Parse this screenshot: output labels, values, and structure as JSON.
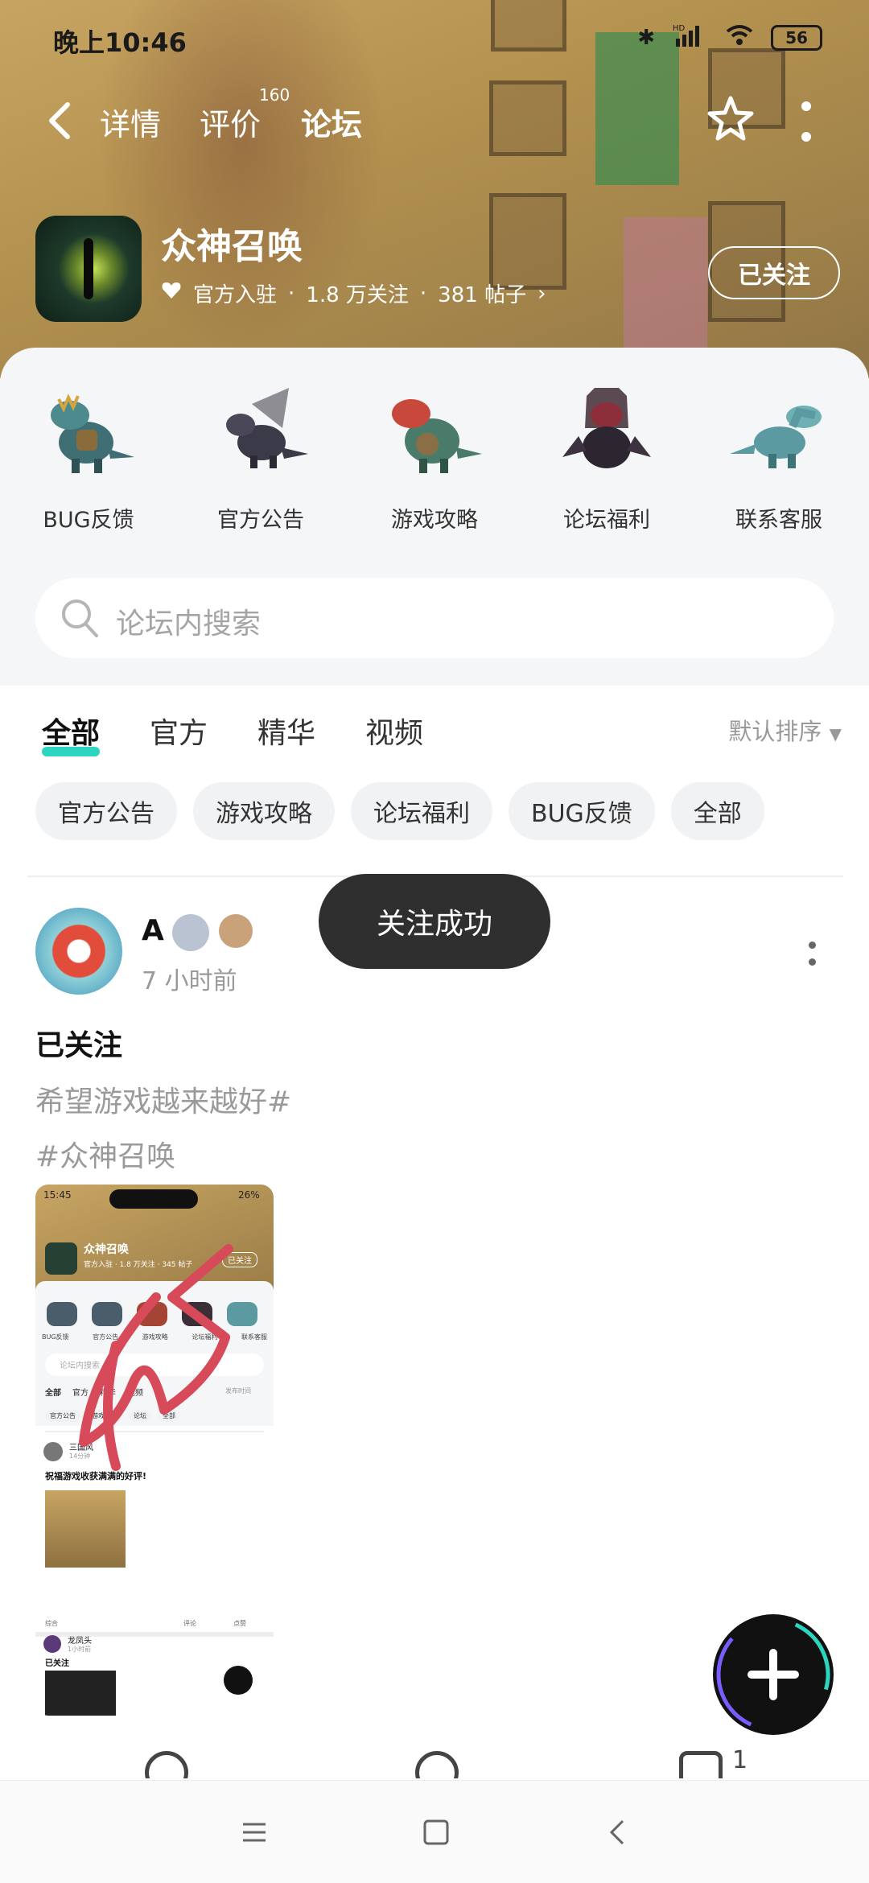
{
  "status_bar": {
    "time": "晚上10:46",
    "battery": "56",
    "network": "HD"
  },
  "nav": {
    "tabs": [
      {
        "label": "详情"
      },
      {
        "label": "评价"
      },
      {
        "label": "论坛"
      }
    ],
    "review_count": "160",
    "active_tab": "论坛"
  },
  "game": {
    "name": "众神召唤",
    "official": "官方入驻",
    "followers": "1.8 万关注",
    "posts": "381 帖子",
    "follow_label": "已关注"
  },
  "shortcuts": [
    {
      "label": "BUG反馈"
    },
    {
      "label": "官方公告"
    },
    {
      "label": "游戏攻略"
    },
    {
      "label": "论坛福利"
    },
    {
      "label": "联系客服"
    }
  ],
  "search": {
    "placeholder": "论坛内搜索"
  },
  "tabs": {
    "items": [
      {
        "label": "全部"
      },
      {
        "label": "官方"
      },
      {
        "label": "精华"
      },
      {
        "label": "视频"
      }
    ],
    "sort_label": "默认排序"
  },
  "chips": [
    {
      "label": "官方公告"
    },
    {
      "label": "游戏攻略"
    },
    {
      "label": "论坛福利"
    },
    {
      "label": "BUG反馈"
    },
    {
      "label": "全部"
    }
  ],
  "toast": "关注成功",
  "post": {
    "author": "A",
    "time": "7 小时前",
    "title": "已关注",
    "body_line1": "希望游戏越来越好#",
    "body_line2": "#众神召唤",
    "thumbnail": {
      "time": "15:45",
      "battery": "26%",
      "game_name": "众神召唤",
      "follow_label": "已关注",
      "followers_line": "官方入驻 · 1.8 万关注 · 345 帖子",
      "shortcuts": [
        "BUG反馈",
        "官方公告",
        "游戏攻略",
        "论坛福利",
        "联系客服"
      ],
      "search_placeholder": "论坛内搜索",
      "tabs": [
        "全部",
        "官方",
        "精华",
        "视频"
      ],
      "sort_label": "发布时间",
      "chips": [
        "官方公告",
        "游戏攻略",
        "论坛",
        "全部"
      ],
      "post1_author": "三国风",
      "post1_time": "14分钟",
      "post1_title": "祝福游戏收获满满的好评!",
      "post1_footer": "综合",
      "post1_comment": "评论",
      "post1_like": "点赞",
      "post2_author": "龙凤头",
      "post2_time": "1小时前",
      "post2_title": "已关注"
    },
    "like_count": "1"
  },
  "colors": {
    "accent": "#2dd4bf",
    "toast_bg": "#2f2f2f"
  }
}
